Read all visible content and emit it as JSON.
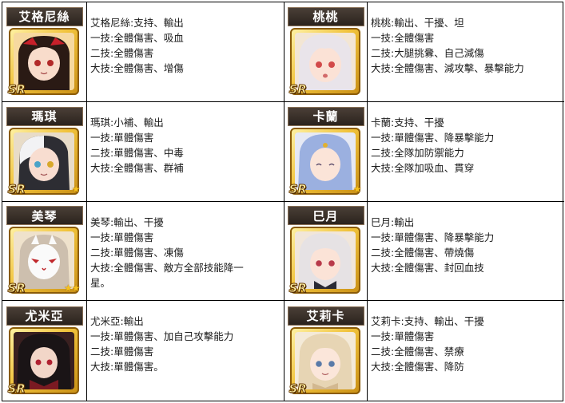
{
  "characters": [
    {
      "name": "艾格尼絲",
      "rarity": "SR",
      "stars": "",
      "lines": [
        "艾格尼絲:支持、輸出",
        "一技:全體傷害、吸血",
        "二技:全體傷害",
        "大技:全體傷害、增傷"
      ]
    },
    {
      "name": "桃桃",
      "rarity": "SR",
      "stars": "",
      "lines": [
        "桃桃:輸出、干擾、坦",
        "一技:全體傷害",
        "二技:大腿挑釁、自己減傷",
        "大技:全體傷害、減攻擊、暴擊能力"
      ]
    },
    {
      "name": "瑪琪",
      "rarity": "SR",
      "stars": "★",
      "lines": [
        "瑪琪:小補、輸出",
        "一技:單體傷害",
        "二技:單體傷害、中毒",
        "大技:全體傷害、群補"
      ]
    },
    {
      "name": "卡蘭",
      "rarity": "SR",
      "stars": "★",
      "lines": [
        "卡蘭:支持、干擾",
        "一技:單體傷害、降暴擊能力",
        "二技:全隊加防禦能力",
        "大技:全隊加吸血、貫穿"
      ]
    },
    {
      "name": "美琴",
      "rarity": "SR",
      "stars": "★★",
      "lines": [
        "美琴:輸出、干擾",
        "一技:單體傷害",
        "二技:單體傷害、凍傷",
        "大技:全體傷害、敵方全部技能降一",
        "星。"
      ]
    },
    {
      "name": "巳月",
      "rarity": "SR",
      "stars": "",
      "lines": [
        "巳月:輸出",
        "一技:單體傷害、降暴擊能力",
        "二技:全體傷害、帶燒傷",
        "大技:全體傷害、封回血技"
      ]
    },
    {
      "name": "尤米亞",
      "rarity": "SR",
      "stars": "",
      "lines": [
        "尤米亞:輸出",
        "一技:單體傷害、加自己攻擊能力",
        "二技:單體傷害",
        "大技:單體傷害。"
      ]
    },
    {
      "name": "艾莉卡",
      "rarity": "SR",
      "stars": "",
      "lines": [
        "艾莉卡:支持、輸出、干擾",
        "一技:單體傷害",
        "二技:全體傷害、禁療",
        "大技:全體傷害、降防"
      ]
    }
  ]
}
